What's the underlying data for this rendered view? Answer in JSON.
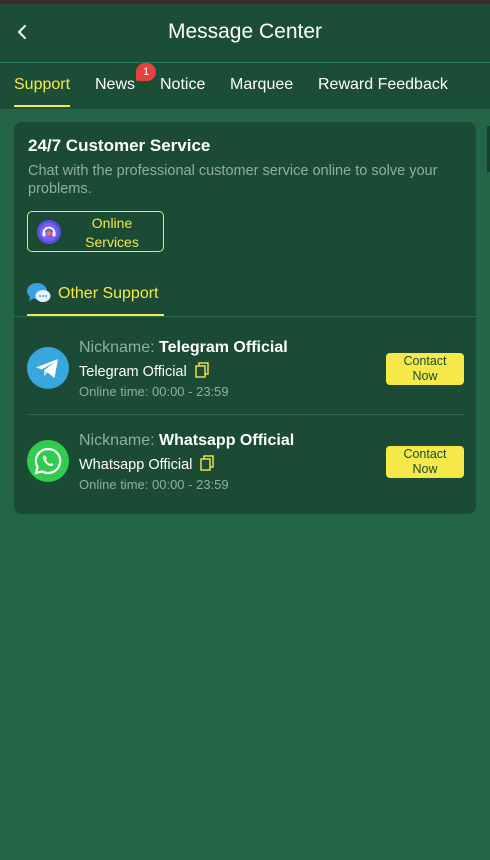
{
  "header": {
    "title": "Message Center",
    "back_icon": "chevron-left-icon"
  },
  "tabs": [
    {
      "label": "Support",
      "active": true
    },
    {
      "label": "News",
      "badge": "1"
    },
    {
      "label": "Notice"
    },
    {
      "label": "Marquee"
    },
    {
      "label": "Reward Feedback"
    }
  ],
  "customer_service": {
    "title": "24/7 Customer Service",
    "description": "Chat with the professional customer service online to solve your problems.",
    "button_label_line1": "Online",
    "button_label_line2": "Services",
    "button_icon": "headset-icon"
  },
  "other_support": {
    "label": "Other Support",
    "icon": "chat-bubbles-icon"
  },
  "contacts": [
    {
      "nickname_label": "Nickname:",
      "nickname": "Telegram Official",
      "name": "Telegram Official",
      "online_time_label": "Online time:",
      "online_time": "00:00 - 23:59",
      "button_label": "Contact Now",
      "icon": "telegram-icon"
    },
    {
      "nickname_label": "Nickname:",
      "nickname": "Whatsapp Official",
      "name": "Whatsapp Official",
      "online_time_label": "Online time:",
      "online_time": "00:00 - 23:59",
      "button_label": "Contact Now",
      "icon": "whatsapp-icon"
    }
  ],
  "colors": {
    "background": "#246447",
    "header": "#1c4e37",
    "card": "#1b4a35",
    "accent": "#f5e94a",
    "badge": "#e8403e"
  }
}
